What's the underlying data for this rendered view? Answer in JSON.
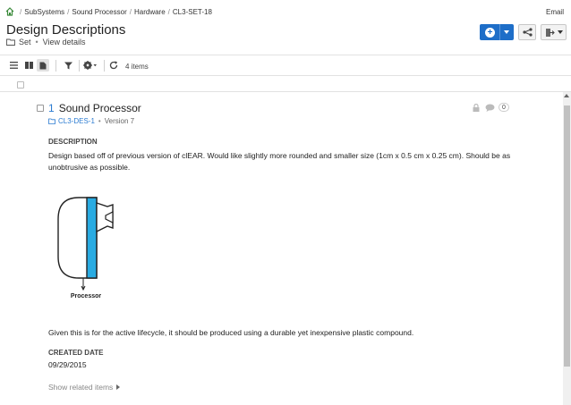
{
  "breadcrumb": {
    "items": [
      "SubSystems",
      "Sound Processor",
      "Hardware",
      "CL3-SET-18"
    ]
  },
  "header": {
    "email_label": "Email",
    "title": "Design Descriptions",
    "type_label": "Set",
    "view_details": "View details"
  },
  "toolbar": {
    "item_count": "4 items"
  },
  "item": {
    "number": "1",
    "name": "Sound Processor",
    "id": "CL3-DES-1",
    "version": "Version 7",
    "comment_count": "0",
    "description_label": "DESCRIPTION",
    "description": "Design based off of previous version of clEAR. Would like slightly more rounded and smaller size (1cm x 0.5 cm x 0.25 cm). Should be as unobtrusive as possible.",
    "drawing_label": "Processor",
    "note": "Given this is for the active lifecycle, it should be produced using a durable yet inexpensive plastic compound.",
    "created_label": "CREATED DATE",
    "created_date": "09/29/2015",
    "related_label": "Show related items"
  },
  "colors": {
    "accent": "#1e6ec8",
    "link": "#2a7bd1",
    "device_band": "#29abe2"
  },
  "icons": [
    "home-icon",
    "folder-icon",
    "plus-icon",
    "share-icon",
    "export-icon",
    "list-view-icon",
    "grid-view-icon",
    "document-view-icon",
    "filter-icon",
    "gear-icon",
    "refresh-icon",
    "lock-icon",
    "comment-icon",
    "caret-right-icon"
  ]
}
